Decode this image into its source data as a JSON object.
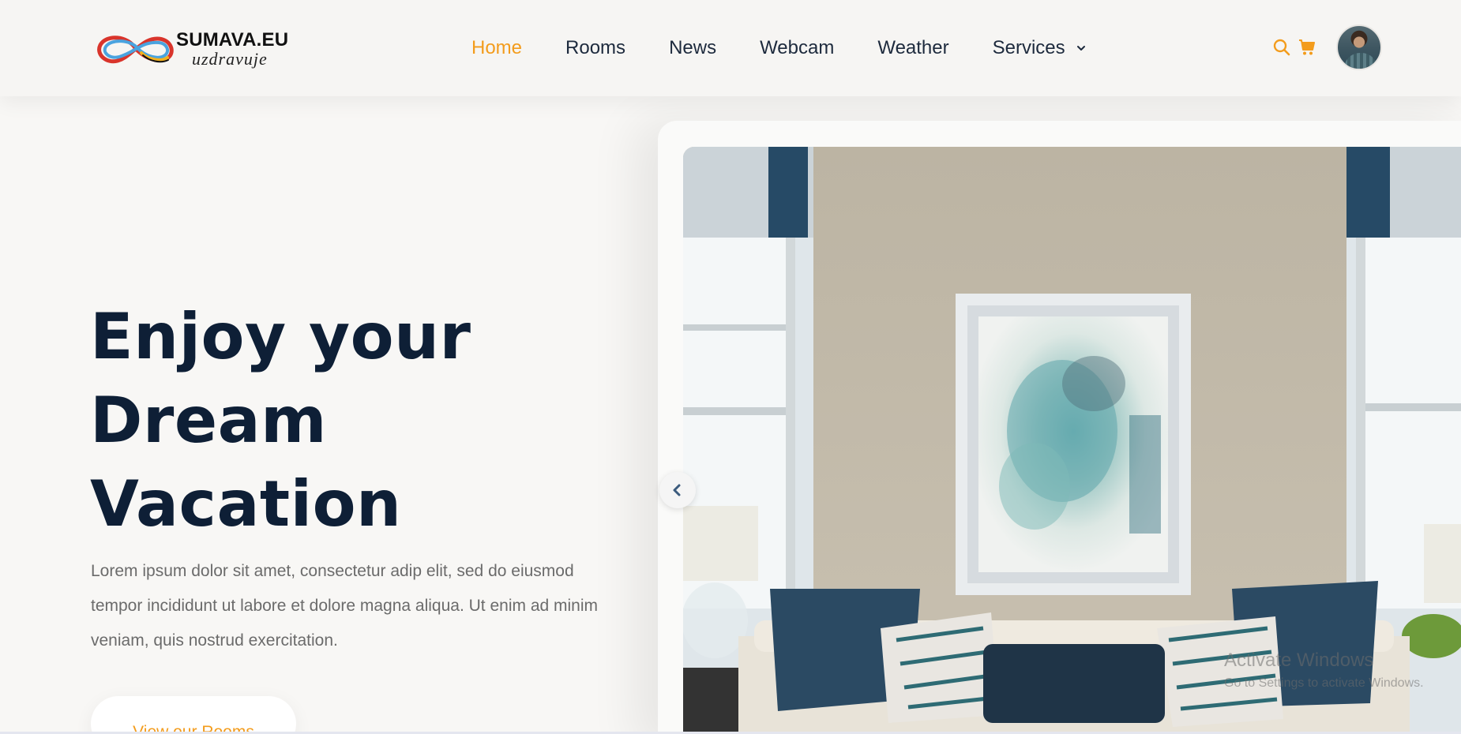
{
  "brand": {
    "title": "SUMAVA.EU",
    "subtitle": "uzdravuje",
    "colors": {
      "red": "#d9342b",
      "blue": "#4aa3df",
      "yellow": "#f2b01e"
    }
  },
  "nav": {
    "items": [
      {
        "label": "Home",
        "active": true
      },
      {
        "label": "Rooms",
        "active": false
      },
      {
        "label": "News",
        "active": false
      },
      {
        "label": "Webcam",
        "active": false
      },
      {
        "label": "Weather",
        "active": false
      },
      {
        "label": "Services",
        "active": false,
        "has_dropdown": true
      }
    ]
  },
  "header_icons": [
    "search-icon",
    "cart-icon",
    "avatar"
  ],
  "hero": {
    "title_lines": [
      "Enjoy your",
      "Dream",
      "Vacation"
    ],
    "description": "Lorem ipsum dolor sit amet, consectetur adip elit, sed do eiusmod tempor incididunt ut labore et dolore magna aliqua. Ut enim ad minim veniam, quis nostrud exercitation.",
    "cta_label": "View our Rooms"
  },
  "watermark": {
    "title": "Activate Windows",
    "subtitle": "Go to Settings to activate Windows."
  },
  "colors": {
    "accent": "#f39c1c",
    "heading": "#0e1f36",
    "body_text": "#6b6b6b",
    "background": "#f8f7f5"
  }
}
